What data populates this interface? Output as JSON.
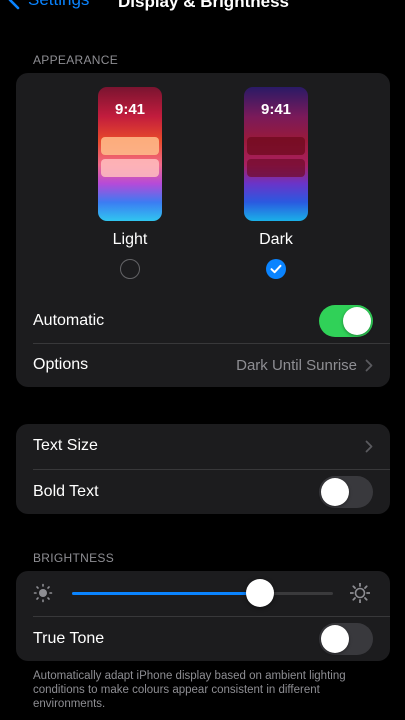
{
  "nav": {
    "back_label": "Settings",
    "title": "Display & Brightness"
  },
  "appearance": {
    "header": "APPEARANCE",
    "light": {
      "time": "9:41",
      "label": "Light",
      "selected": false
    },
    "dark": {
      "time": "9:41",
      "label": "Dark",
      "selected": true
    },
    "automatic": {
      "label": "Automatic",
      "on": true
    },
    "options": {
      "label": "Options",
      "value": "Dark Until Sunrise"
    }
  },
  "text": {
    "text_size_label": "Text Size",
    "bold_text": {
      "label": "Bold Text",
      "on": false
    }
  },
  "brightness": {
    "header": "BRIGHTNESS",
    "level": 0.72,
    "true_tone": {
      "label": "True Tone",
      "on": false
    },
    "footnote": "Automatically adapt iPhone display based on ambient lighting conditions to make colours appear consistent in different environments."
  },
  "colors": {
    "accent": "#0a84ff",
    "toggle_on": "#30d158",
    "card": "#1c1c1e"
  },
  "icons": {
    "back": "chevron-left-icon",
    "chevron": "chevron-right-icon",
    "check": "checkmark-icon",
    "sun_small": "sun-min-icon",
    "sun_large": "sun-max-icon"
  }
}
